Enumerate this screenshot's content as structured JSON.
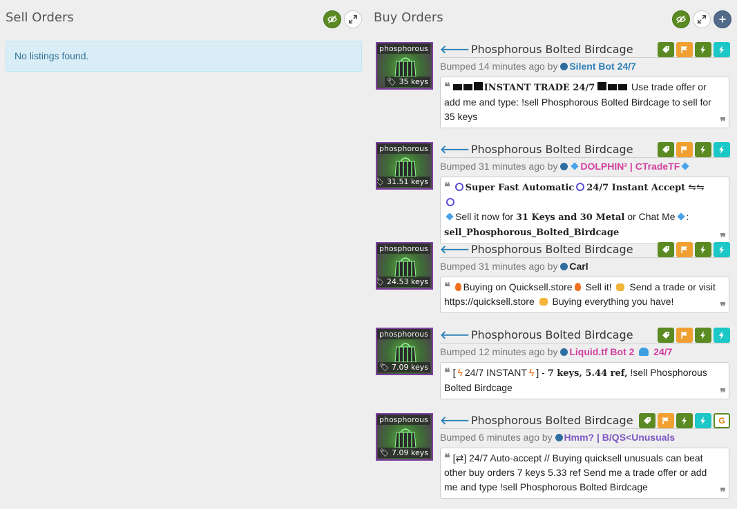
{
  "sell": {
    "title": "Sell Orders",
    "empty_message": "No listings found."
  },
  "buy": {
    "title": "Buy Orders"
  },
  "listings": [
    {
      "thumb_label": "phosphorous",
      "price": "35 keys",
      "title": "Phosphorous Bolted Birdcage",
      "bumped": "Bumped 14 minutes ago by",
      "user": "Silent Bot 24/7",
      "message": {
        "bold": "INSTANT TRADE 24/7",
        "text": "Use trade offer or add me and type: !sell Phosphorous Bolted Birdcage to sell for 35 keys"
      }
    },
    {
      "thumb_label": "phosphorous",
      "price": "31.51 keys",
      "title": "Phosphorous Bolted Birdcage",
      "bumped": "Bumped 31 minutes ago by",
      "user": "DOLPHIN² | CTradeTF",
      "message": {
        "bold1": "Super Fast Automatic",
        "bold2": "24/7 Instant Accept",
        "arrows": "⇋⇋",
        "text1": "Sell it now for",
        "bold3": "31 Keys and 30 Metal",
        "text2": "or Chat Me",
        "colon": ":",
        "bold4": "sell_Phosphorous_Bolted_Birdcage"
      }
    },
    {
      "thumb_label": "phosphorous",
      "price": "24.53 keys",
      "title": "Phosphorous Bolted Birdcage",
      "bumped": "Bumped 31 minutes ago by",
      "user": "Carl",
      "message": {
        "text1": "Buying on Quicksell.store",
        "text2": "Sell it!",
        "text3": "Send a trade or visit https://quicksell.store",
        "text4": "Buying everything you have!"
      }
    },
    {
      "thumb_label": "phosphorous",
      "price": "7.09 keys",
      "title": "Phosphorous Bolted Birdcage",
      "bumped": "Bumped 12 minutes ago by",
      "user": "Liquid.tf Bot 2",
      "user_suffix": "24/7",
      "message": {
        "open": "[",
        "text1": "24/7 INSTANT",
        "text2": "] -",
        "bold": "7 keys, 5.44 ref,",
        "text3": "!sell Phosphorous Bolted Birdcage"
      }
    },
    {
      "thumb_label": "phosphorous",
      "price": "7.09 keys",
      "title": "Phosphorous Bolted Birdcage",
      "bumped": "Bumped 6 minutes ago by",
      "user": "Hmm? | B/QS<Unusuals",
      "message": {
        "text": "[⇄] 24/7 Auto-accept // Buying quicksell unusuals can beat other buy orders 7 keys 5.33 ref Send me a trade offer or add me and type !sell Phosphorous Bolted Birdcage"
      }
    }
  ],
  "colors": {
    "accent_green": "#5b8a23",
    "orange": "#f0a030",
    "cyan": "#1cc7c7",
    "quality_purple": "#7d3fa0",
    "info_bg": "#d9edf7"
  },
  "icons": {
    "hide": "eye-slash-icon",
    "expand": "expand-icon",
    "add": "plus-icon",
    "tag": "tag-icon",
    "flag": "flag-icon",
    "bolt": "bolt-icon"
  }
}
